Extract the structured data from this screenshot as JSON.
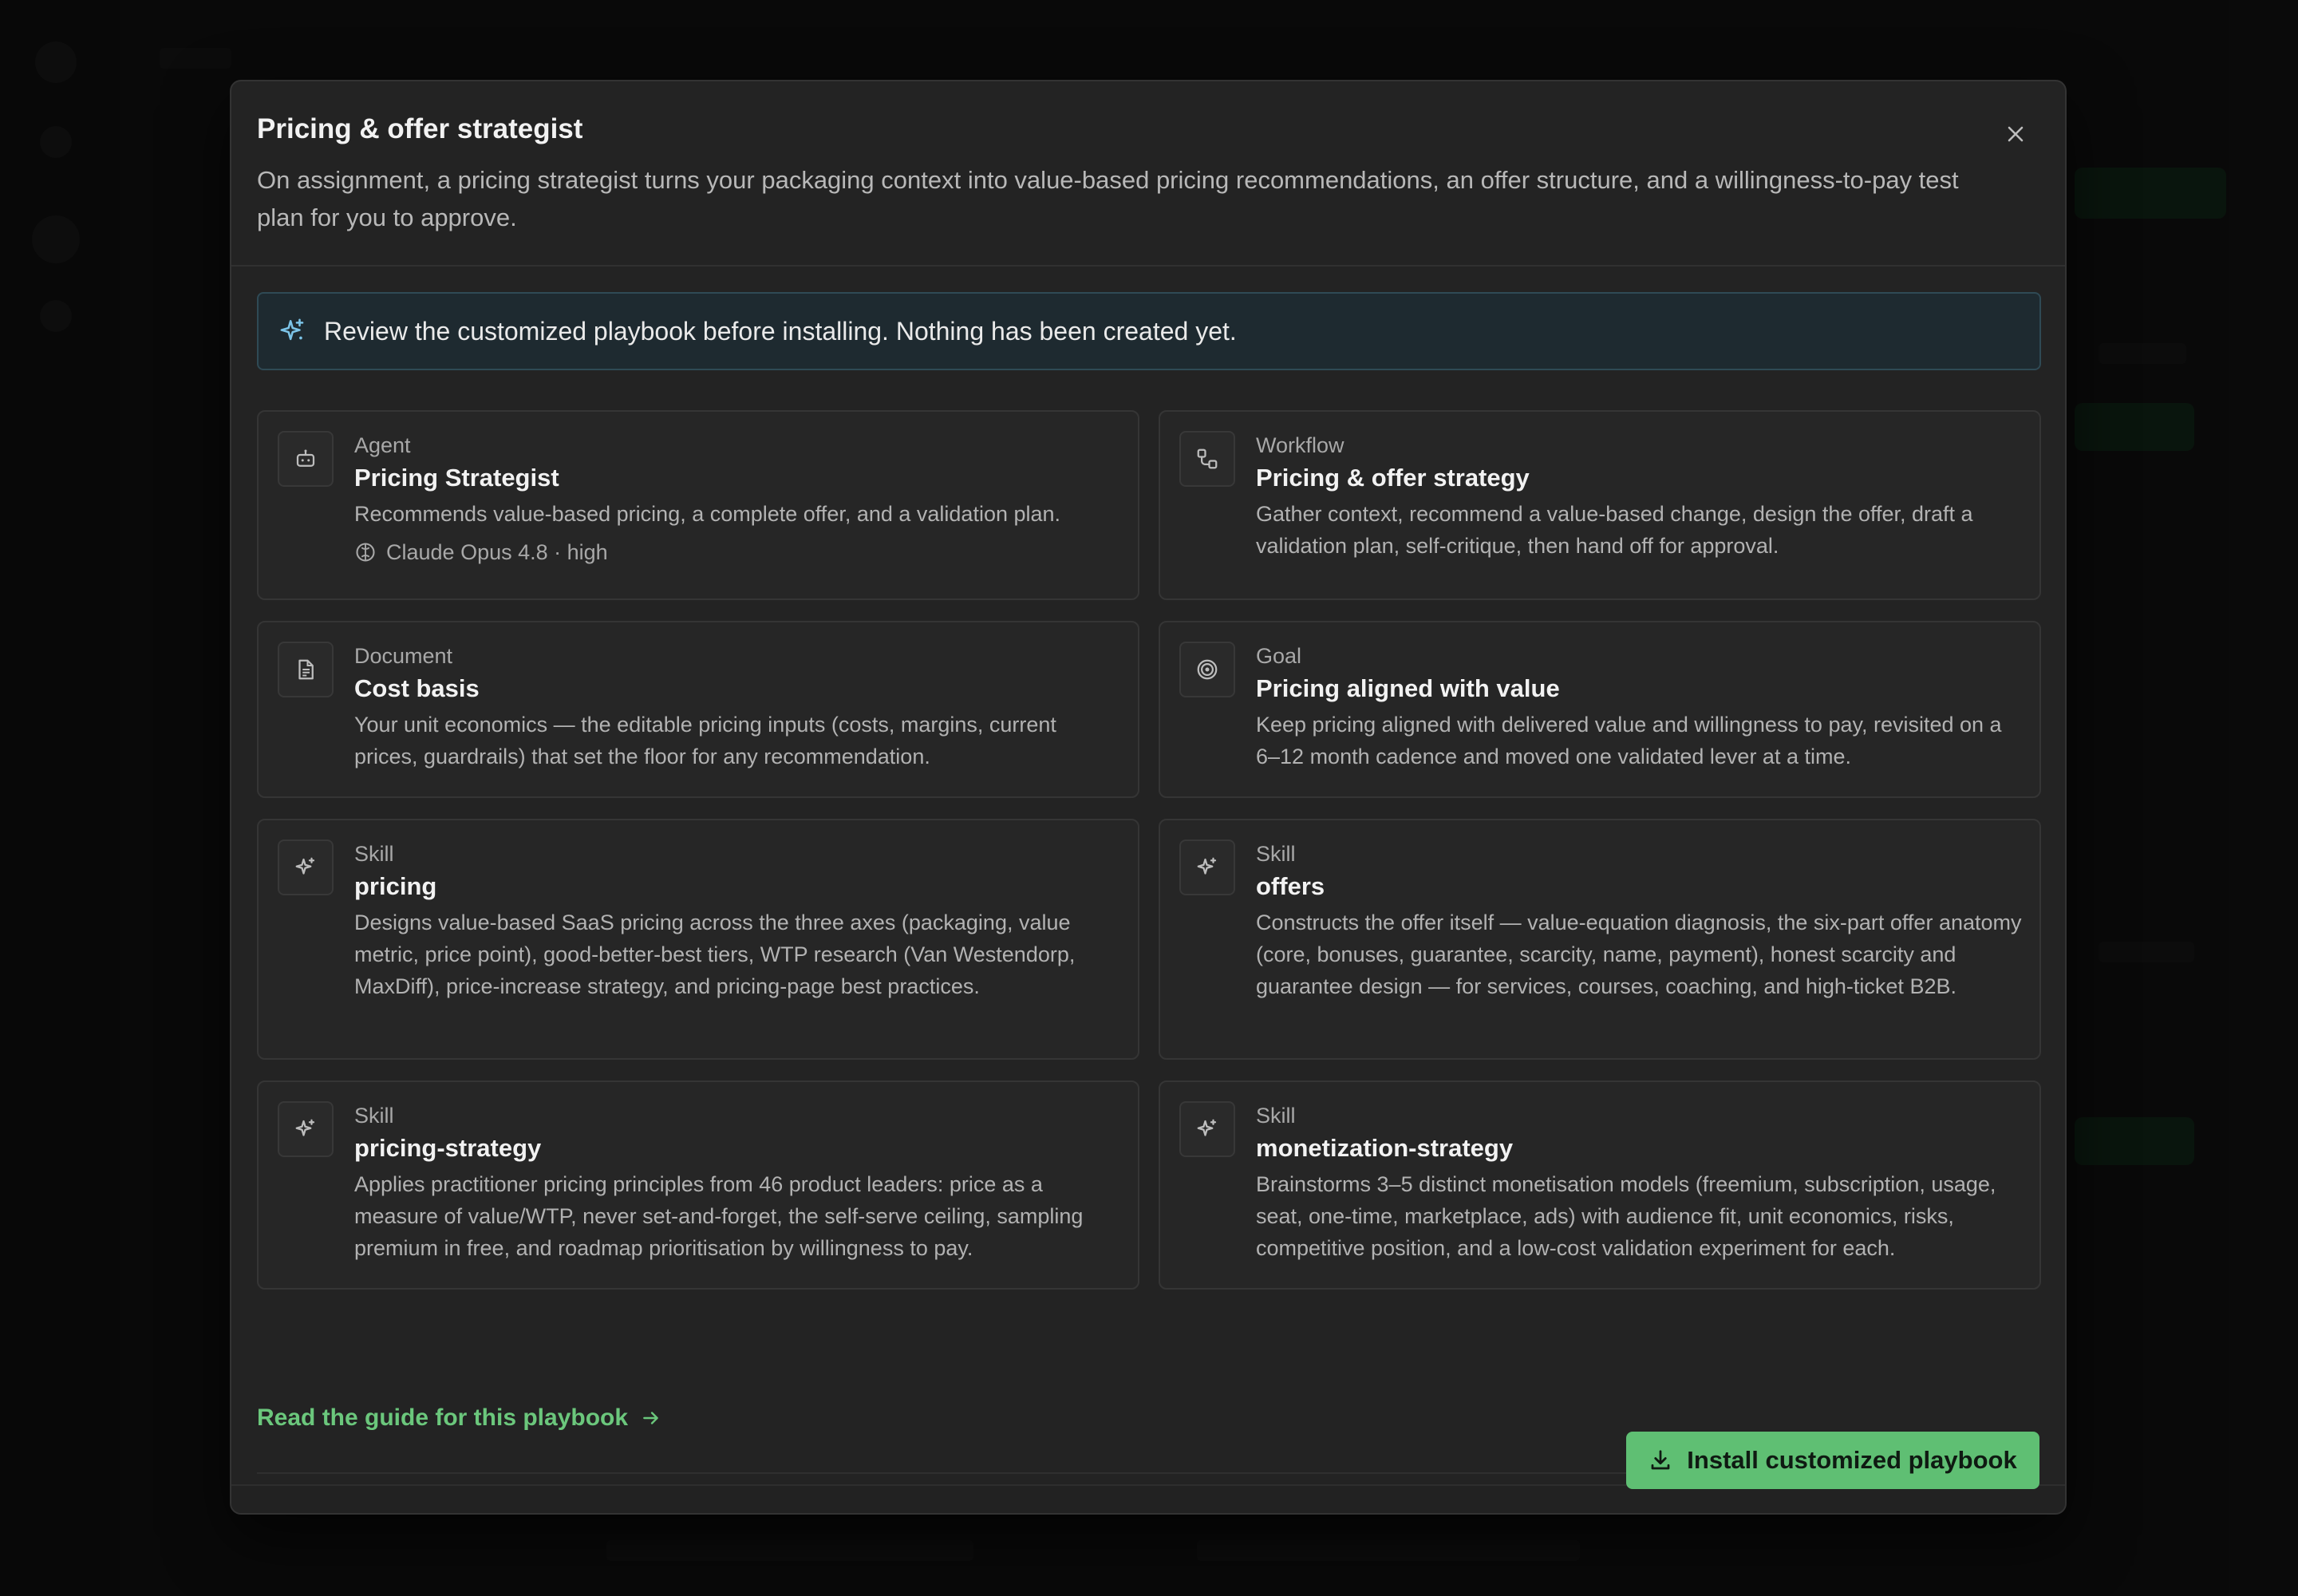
{
  "modal": {
    "title": "Pricing & offer strategist",
    "description": "On assignment, a pricing strategist turns your packaging context into value-based pricing recommendations, an offer structure, and a willingness-to-pay test plan for you to approve.",
    "close_icon": "close-icon"
  },
  "notice": {
    "icon": "sparkles-icon",
    "text": "Review the customized playbook before installing. Nothing has been created yet."
  },
  "cards": [
    {
      "kind": "Agent",
      "title": "Pricing Strategist",
      "description": "Recommends value-based pricing, a complete offer, and a validation plan.",
      "meta": "Claude Opus 4.8 · high",
      "icon": "bot-icon"
    },
    {
      "kind": "Workflow",
      "title": "Pricing & offer strategy",
      "description": "Gather context, recommend a value-based change, design the offer, draft a validation plan, self-critique, then hand off for approval.",
      "icon": "workflow-icon"
    },
    {
      "kind": "Document",
      "title": "Cost basis",
      "description": "Your unit economics — the editable pricing inputs (costs, margins, current prices, guardrails) that set the floor for any recommendation.",
      "icon": "document-icon"
    },
    {
      "kind": "Goal",
      "title": "Pricing aligned with value",
      "description": "Keep pricing aligned with delivered value and willingness to pay, revisited on a 6–12 month cadence and moved one validated lever at a time.",
      "icon": "target-icon"
    },
    {
      "kind": "Skill",
      "title": "pricing",
      "description": "Designs value-based SaaS pricing across the three axes (packaging, value metric, price point), good-better-best tiers, WTP research (Van Westendorp, MaxDiff), price-increase strategy, and pricing-page best practices.",
      "icon": "sparkles-icon"
    },
    {
      "kind": "Skill",
      "title": "offers",
      "description": "Constructs the offer itself — value-equation diagnosis, the six-part offer anatomy (core, bonuses, guarantee, scarcity, name, payment), honest scarcity and guarantee design — for services, courses, coaching, and high-ticket B2B.",
      "icon": "sparkles-icon"
    },
    {
      "kind": "Skill",
      "title": "pricing-strategy",
      "description": "Applies practitioner pricing principles from 46 product leaders: price as a measure of value/WTP, never set-and-forget, the self-serve ceiling, sampling premium in free, and roadmap prioritisation by willingness to pay.",
      "icon": "sparkles-icon"
    },
    {
      "kind": "Skill",
      "title": "monetization-strategy",
      "description": "Brainstorms 3–5 distinct monetisation models (freemium, subscription, usage, seat, one-time, marketplace, ads) with audience fit, unit economics, risks, competitive position, and a low-cost validation experiment for each.",
      "icon": "sparkles-icon"
    }
  ],
  "guide_link": {
    "label": "Read the guide for this playbook",
    "icon": "arrow-right-icon"
  },
  "install_button": {
    "label": "Install customized playbook",
    "icon": "download-icon"
  },
  "colors": {
    "accent": "#5fbf73",
    "link": "#6bc77c",
    "notice_bg": "#1e2a30",
    "notice_icon": "#7cc4e8"
  }
}
